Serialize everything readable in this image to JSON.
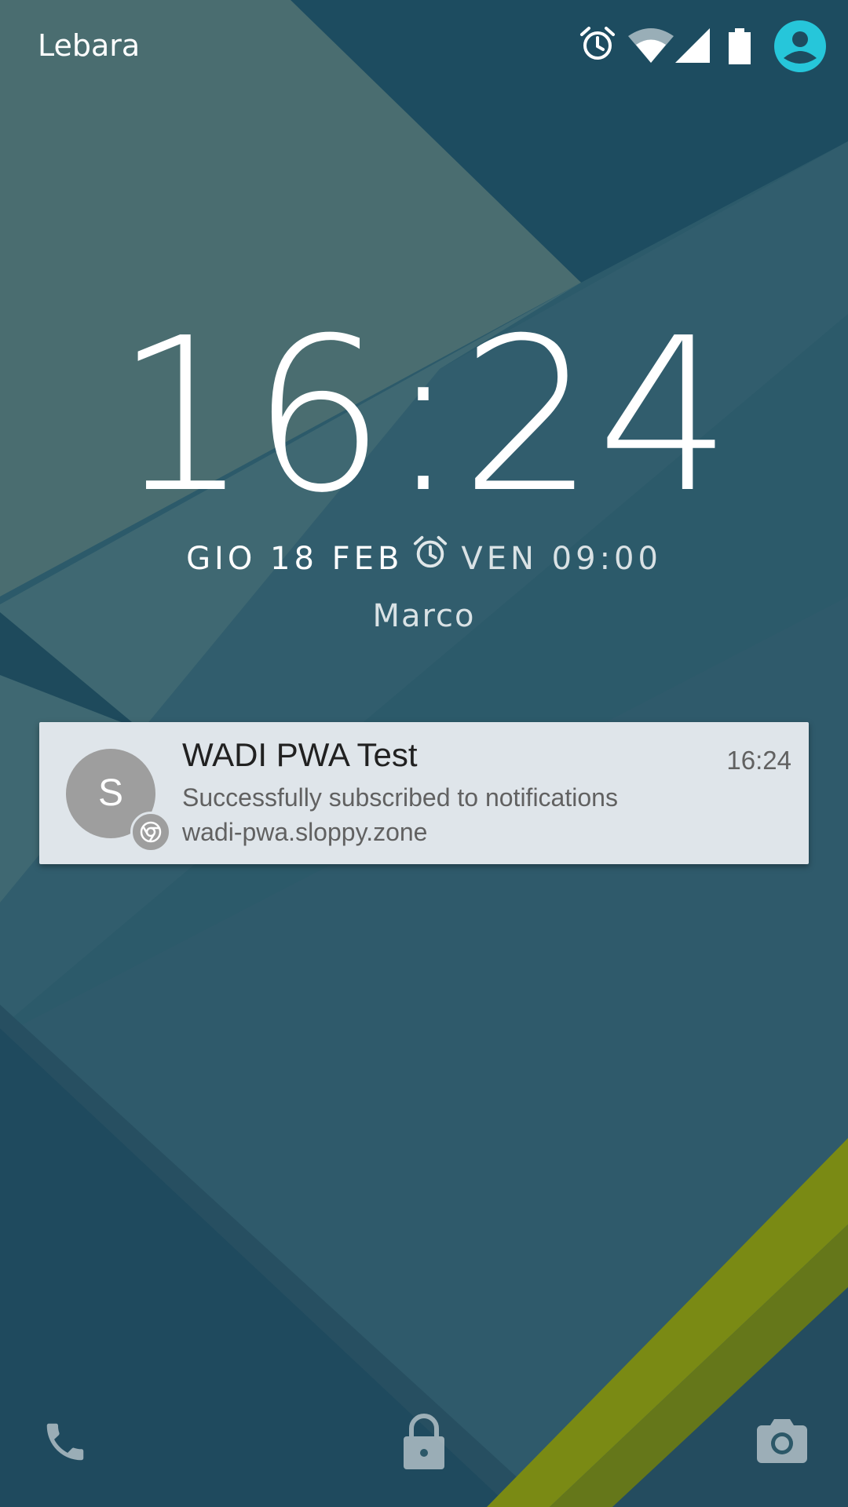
{
  "status_bar": {
    "carrier": "Lebara",
    "icons": [
      "alarm-icon",
      "wifi-icon",
      "cell-signal-icon",
      "battery-icon",
      "user-avatar-icon"
    ],
    "accent_color": "#26c6da"
  },
  "lockscreen": {
    "time": "16:24",
    "date": "GIO 18 FEB",
    "alarm": "VEN 09:00",
    "owner": "Marco"
  },
  "notification": {
    "avatar_letter": "S",
    "badge_icon": "chrome-icon",
    "title": "WADI PWA Test",
    "time": "16:24",
    "body": "Successfully subscribed to notifications",
    "origin": "wadi-pwa.sloppy.zone"
  },
  "bottom_bar": {
    "icons": [
      "phone-icon",
      "lock-icon",
      "camera-icon"
    ]
  },
  "colors": {
    "wallpaper_base": "#2c5868",
    "wallpaper_accent": "#8a9a10",
    "card_background": "#dfe5ea"
  }
}
